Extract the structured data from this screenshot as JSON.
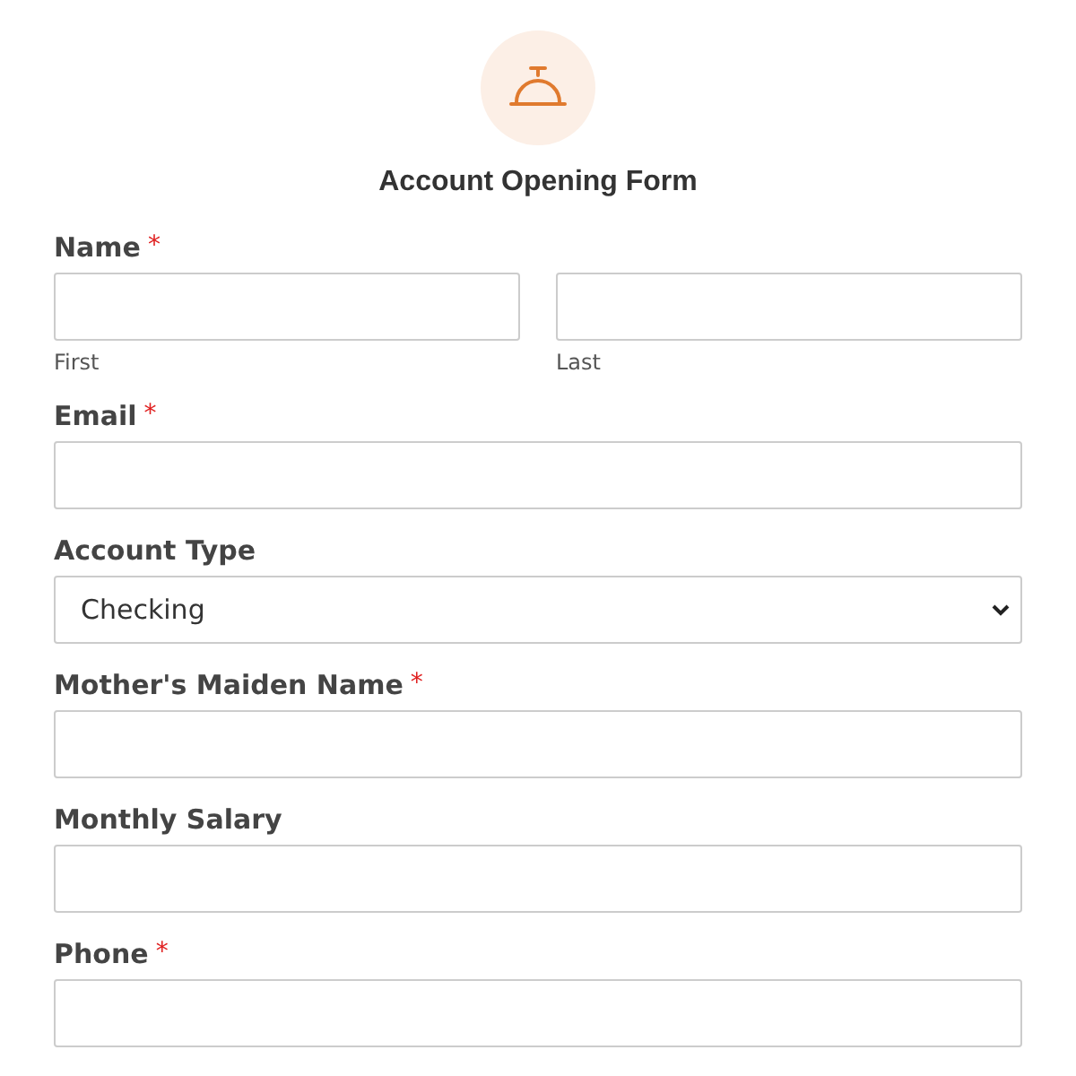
{
  "title": "Account Opening Form",
  "fields": [
    {
      "kind": "name",
      "label": "Name",
      "required_mark": "*",
      "parts": [
        {
          "sublabel": "First"
        },
        {
          "sublabel": "Last"
        }
      ]
    },
    {
      "kind": "text",
      "label": "Email",
      "required_mark": "*"
    },
    {
      "kind": "select",
      "label": "Account Type",
      "value": "Checking"
    },
    {
      "kind": "text",
      "label": "Mother's Maiden Name",
      "required_mark": "*"
    },
    {
      "kind": "text",
      "label": "Monthly Salary"
    },
    {
      "kind": "text",
      "label": "Phone",
      "required_mark": "*"
    }
  ]
}
